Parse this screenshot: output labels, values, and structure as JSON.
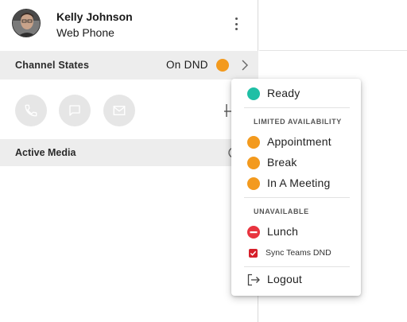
{
  "profile": {
    "name": "Kelly Johnson",
    "device": "Web Phone"
  },
  "channel": {
    "label": "Channel States",
    "state": "On DND",
    "state_color": "#f39a1e"
  },
  "media_section": {
    "label": "Active Media"
  },
  "icons": [
    "phone-icon",
    "chat-icon",
    "mail-icon",
    "more-vert-icon",
    "chevron-right-icon",
    "logout-icon"
  ],
  "status_menu": {
    "ready": {
      "label": "Ready",
      "color": "#1fbfa5"
    },
    "limited_heading": "LIMITED AVAILABILITY",
    "limited": [
      {
        "label": "Appointment",
        "color": "#f39a1e"
      },
      {
        "label": "Break",
        "color": "#f39a1e"
      },
      {
        "label": "In A Meeting",
        "color": "#f39a1e"
      }
    ],
    "unavailable_heading": "UNAVAILABLE",
    "lunch": {
      "label": "Lunch",
      "color": "#e8343f"
    },
    "sync_teams": {
      "label": "Sync Teams DND",
      "checked": true
    },
    "logout": {
      "label": "Logout"
    }
  },
  "colors": {
    "panel_bg": "#ededed",
    "button_bg": "#e6e6e6",
    "checkbox": "#d61f2a"
  }
}
